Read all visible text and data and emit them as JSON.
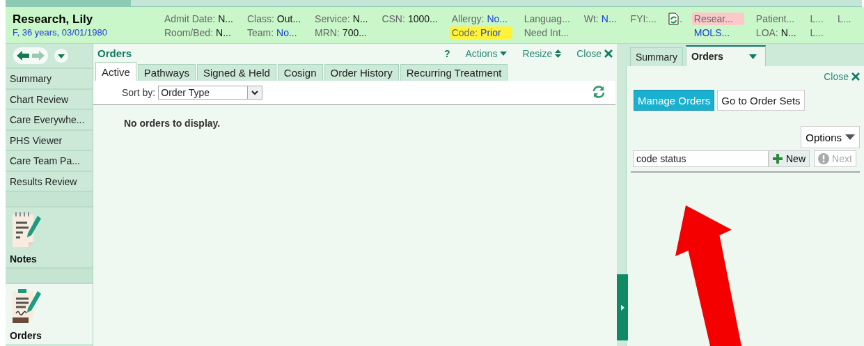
{
  "patient": {
    "name": "Research, Lily",
    "details": "F, 36 years, 03/01/1980"
  },
  "header": {
    "columns": [
      [
        {
          "kind": "field",
          "label": "Admit Date:",
          "value": "N...",
          "link": false
        },
        {
          "kind": "field",
          "label": "Room/Bed:",
          "value": "N...",
          "link": false
        }
      ],
      [
        {
          "kind": "field",
          "label": "Class:",
          "value": "Out...",
          "link": false
        },
        {
          "kind": "field",
          "label": "Team:",
          "value": "No...",
          "link": true
        }
      ],
      [
        {
          "kind": "field",
          "label": "Service:",
          "value": "N...",
          "link": false
        },
        {
          "kind": "field",
          "label": "MRN:",
          "value": "700...",
          "link": false
        }
      ],
      [
        {
          "kind": "field",
          "label": "CSN:",
          "value": "1000...",
          "link": false
        }
      ],
      [
        {
          "kind": "field",
          "label": "Allergy:",
          "value": "No...",
          "link": true
        },
        {
          "kind": "field",
          "label": "Code:",
          "value": "Prior",
          "link": true,
          "color": "#fff33a"
        }
      ],
      [
        {
          "kind": "field",
          "label": "Languag..."
        },
        {
          "kind": "field",
          "label": "Need Int..."
        }
      ],
      [
        {
          "kind": "field",
          "label": "Wt:",
          "value": "N...",
          "link": true
        }
      ],
      [
        {
          "kind": "field",
          "label": "FYI:..."
        }
      ],
      [
        {
          "kind": "icon",
          "label": "."
        }
      ],
      [
        {
          "kind": "field",
          "label": "Resear...",
          "color": "#fbc9c9"
        },
        {
          "kind": "field",
          "value": "MOLS...",
          "link": true
        }
      ],
      [
        {
          "kind": "field",
          "label": "Patient..."
        },
        {
          "kind": "field",
          "label": "LOA:",
          "value": "N...",
          "link": false
        }
      ],
      [
        {
          "kind": "field",
          "label": "L..."
        },
        {
          "kind": "field",
          "label": "L..."
        }
      ],
      [
        {
          "kind": "field",
          "label": "L..."
        }
      ]
    ]
  },
  "sidebar": {
    "items": [
      {
        "kind": "link",
        "label": "Summary"
      },
      {
        "kind": "link",
        "label": "Chart Review"
      },
      {
        "kind": "link",
        "label": "Care Everywhe..."
      },
      {
        "kind": "link",
        "label": "PHS Viewer"
      },
      {
        "kind": "link",
        "label": "Care Team Pa..."
      },
      {
        "kind": "link",
        "label": "Results Review"
      },
      {
        "kind": "notes",
        "label": "Notes",
        "selected": false
      },
      {
        "kind": "orders",
        "label": "Orders",
        "selected": true
      }
    ]
  },
  "orders_panel": {
    "title": "Orders",
    "help": "?",
    "actions": "Actions",
    "resize": "Resize",
    "close": "Close",
    "tabs": [
      {
        "label": "Active",
        "selected": true
      },
      {
        "label": "Pathways",
        "selected": false
      },
      {
        "label": "Signed & Held",
        "selected": false
      },
      {
        "label": "Cosign",
        "selected": false
      },
      {
        "label": "Order History",
        "selected": false
      },
      {
        "label": "Recurring Treatment",
        "selected": false
      }
    ],
    "sort_label": "Sort by:",
    "sort_value": "Order Type",
    "empty_message": "No orders to display."
  },
  "side_panel": {
    "tabs": [
      {
        "label": "Summary",
        "selected": false
      },
      {
        "label": "Orders",
        "selected": true
      }
    ],
    "close": "Close",
    "modes": [
      {
        "label": "Manage Orders",
        "selected": true
      },
      {
        "label": "Go to Order Sets",
        "selected": false
      }
    ],
    "options": "Options",
    "search_value": "code status",
    "new_button": "New",
    "next_button": {
      "label": "Next",
      "disabled": true
    }
  },
  "annotations": [
    {
      "kind": "arrow"
    }
  ]
}
